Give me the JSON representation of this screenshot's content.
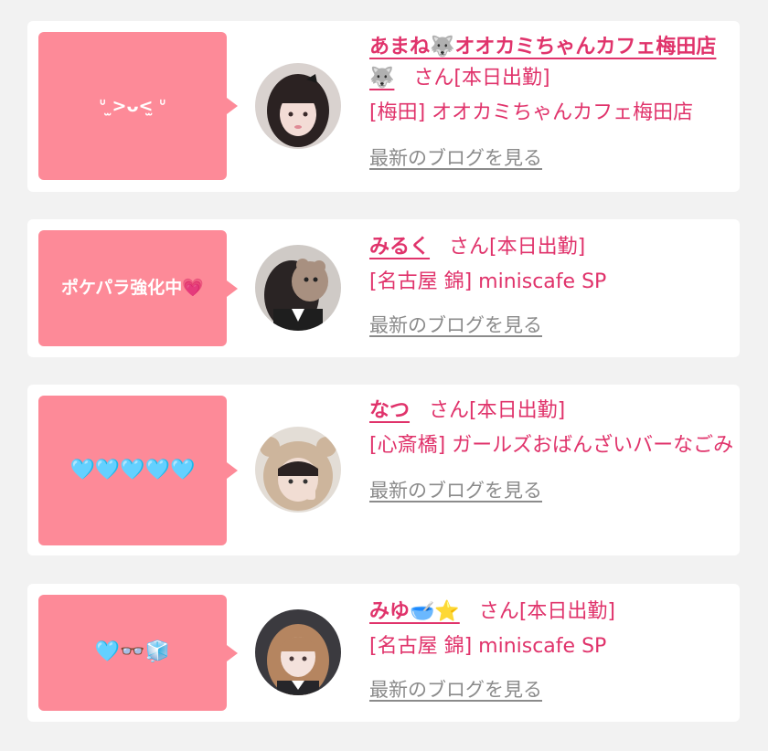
{
  "colors": {
    "background": "#f2f2f2",
    "card": "#ffffff",
    "bubble": "#fd8a98",
    "accent": "#e0336b",
    "link_gray": "#8b8b8b"
  },
  "cards": [
    {
      "bubble_text": "ᐡ ̫>ᴗ<̫ ᐡ",
      "name": "あまね🐺オオカミちゃんカフェ梅田店🐺",
      "san": "さん",
      "status": "[本日出勤]",
      "shop": "[梅田] オオカミちゃんカフェ梅田店",
      "blog_link": "最新のブログを見る",
      "avatar_icon": "profile-photo-dark-hair"
    },
    {
      "bubble_text": "ポケパラ強化中💗",
      "name": "みるく",
      "san": "さん",
      "status": "[本日出勤]",
      "shop": "[名古屋 錦] miniscafe SP",
      "blog_link": "最新のブログを見る",
      "avatar_icon": "profile-photo-animal-mask"
    },
    {
      "bubble_text": "🩵🩵🩵🩵🩵",
      "name": "なつ",
      "san": "さん",
      "status": "[本日出勤]",
      "shop": "[心斎橋] ガールズおばんざいバーなごみ",
      "blog_link": "最新のブログを見る",
      "avatar_icon": "profile-photo-bear-hood"
    },
    {
      "bubble_text": "🩵👓🧊",
      "name": "みゆ🥣⭐️",
      "san": "さん",
      "status": "[本日出勤]",
      "shop": "[名古屋 錦] miniscafe SP",
      "blog_link": "最新のブログを見る",
      "avatar_icon": "profile-photo-brown-hair"
    }
  ]
}
